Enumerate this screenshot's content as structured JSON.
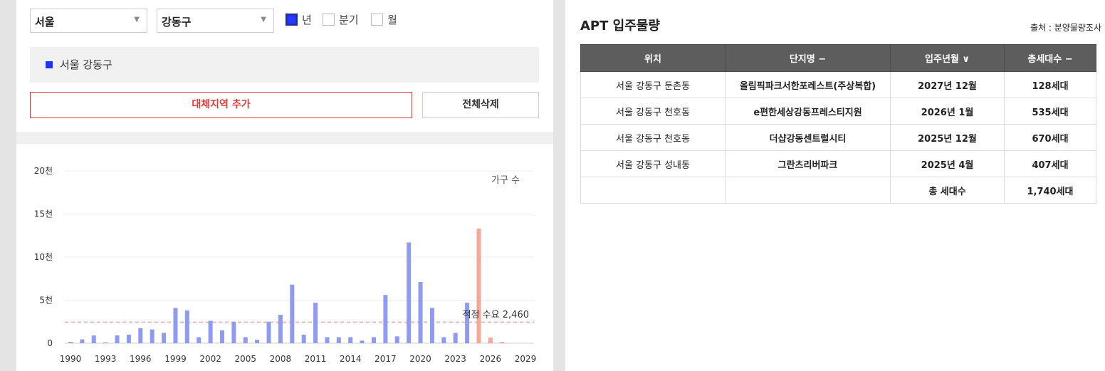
{
  "filters": {
    "region_select": "서울",
    "district_select": "강동구",
    "period_options": [
      {
        "label": "년",
        "checked": true
      },
      {
        "label": "분기",
        "checked": false
      },
      {
        "label": "월",
        "checked": false
      }
    ]
  },
  "selected_region": {
    "label": "서울 강동구",
    "color": "#1f33ff"
  },
  "buttons": {
    "add_region": "대체지역 추가",
    "delete_all": "전체삭제"
  },
  "chart_data": {
    "type": "bar",
    "legend": "가구 수",
    "x": [
      1990,
      1991,
      1992,
      1993,
      1994,
      1995,
      1996,
      1997,
      1998,
      1999,
      2000,
      2001,
      2002,
      2003,
      2004,
      2005,
      2006,
      2007,
      2008,
      2009,
      2010,
      2011,
      2012,
      2013,
      2014,
      2015,
      2016,
      2017,
      2018,
      2019,
      2020,
      2021,
      2022,
      2023,
      2024,
      2025,
      2026,
      2027,
      2028,
      2029
    ],
    "values": [
      150,
      450,
      900,
      100,
      900,
      1000,
      1750,
      1600,
      1200,
      4100,
      3800,
      700,
      2600,
      1500,
      2500,
      700,
      400,
      2500,
      3300,
      6800,
      1000,
      4700,
      700,
      700,
      700,
      300,
      700,
      5600,
      800,
      11700,
      7100,
      4100,
      700,
      1200,
      4700,
      13300,
      650,
      150,
      0,
      0
    ],
    "forecast_from": 2025,
    "x_tick_labels": [
      "1990",
      "1993",
      "1996",
      "1999",
      "2002",
      "2005",
      "2008",
      "2011",
      "2014",
      "2017",
      "2020",
      "2023",
      "2026",
      "2029"
    ],
    "y_tick_labels": [
      "0",
      "5천",
      "10천",
      "15천",
      "20천"
    ],
    "ylim": [
      0,
      20000
    ],
    "reference_line": {
      "value": 2460,
      "label": "적정 수요 2,460"
    },
    "colors": {
      "actual": "#8f9af2",
      "forecast": "#f5a79a",
      "reference": "#f19a9a"
    }
  },
  "supply_table": {
    "title": "APT 입주물량",
    "source": "출처 : 분양물량조사",
    "headers": [
      "위치",
      "단지명 −",
      "입주년월 ∨",
      "총세대수 −"
    ],
    "rows": [
      [
        "서울 강동구 둔촌동",
        "올림픽파크서한포레스트(주상복합)",
        "2027년 12월",
        "128세대"
      ],
      [
        "서울 강동구 천호동",
        "e편한세상강동프레스티지원",
        "2026년 1월",
        "535세대"
      ],
      [
        "서울 강동구 천호동",
        "더샵강동센트럴시티",
        "2025년 12월",
        "670세대"
      ],
      [
        "서울 강동구 성내동",
        "그란츠리버파크",
        "2025년 4월",
        "407세대"
      ]
    ],
    "total_label": "총 세대수",
    "total_value": "1,740세대"
  }
}
